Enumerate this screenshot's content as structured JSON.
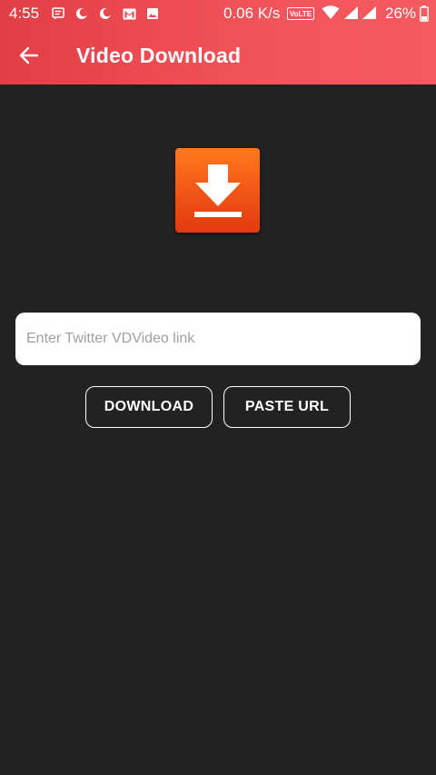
{
  "status_bar": {
    "time": "4:55",
    "network_speed": "0.06 K/s",
    "volte_label": "VoLTE",
    "battery_percent": "26%",
    "left_icons": [
      "message-icon",
      "moon-icon",
      "moon-icon",
      "gmail-icon",
      "image-icon"
    ]
  },
  "app_bar": {
    "title": "Video Download",
    "back_icon": "arrow-left-icon"
  },
  "logo": {
    "icon": "download-icon",
    "color_top": "#ff7a1f",
    "color_bottom": "#e13a10"
  },
  "url_input": {
    "value": "",
    "placeholder": "Enter Twitter VDVideo link"
  },
  "actions": {
    "download_label": "DOWNLOAD",
    "paste_label": "PASTE URL"
  },
  "colors": {
    "header_accent": "#f2545a",
    "background": "#222222"
  }
}
